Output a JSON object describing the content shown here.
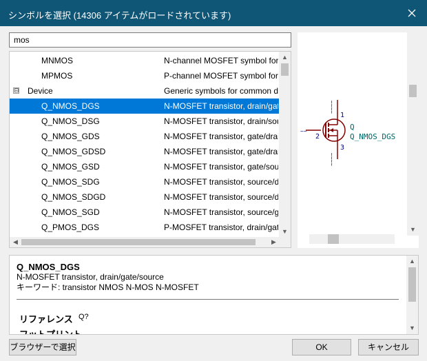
{
  "window": {
    "title": "シンボルを選択 (14306 アイテムがロードされています)"
  },
  "search": {
    "value": "mos"
  },
  "tree": {
    "rows": [
      {
        "name": "MNMOS",
        "desc": "N-channel MOSFET symbol for"
      },
      {
        "name": "MPMOS",
        "desc": "P-channel MOSFET symbol for s"
      },
      {
        "name": "Device",
        "desc": "Generic symbols for common de",
        "expander": "⊟"
      },
      {
        "name": "Q_NMOS_DGS",
        "desc": "N-MOSFET transistor, drain/gate"
      },
      {
        "name": "Q_NMOS_DSG",
        "desc": "N-MOSFET transistor, drain/sou"
      },
      {
        "name": "Q_NMOS_GDS",
        "desc": "N-MOSFET transistor, gate/drain"
      },
      {
        "name": "Q_NMOS_GDSD",
        "desc": "N-MOSFET transistor, gate/drain"
      },
      {
        "name": "Q_NMOS_GSD",
        "desc": "N-MOSFET transistor, gate/sour"
      },
      {
        "name": "Q_NMOS_SDG",
        "desc": "N-MOSFET transistor, source/dr"
      },
      {
        "name": "Q_NMOS_SDGD",
        "desc": "N-MOSFET transistor, source/dr"
      },
      {
        "name": "Q_NMOS_SGD",
        "desc": "N-MOSFET transistor, source/ga"
      },
      {
        "name": "Q_PMOS_DGS",
        "desc": "P-MOSFET transistor, drain/gate"
      }
    ]
  },
  "preview": {
    "ref": "Q",
    "value": "Q_NMOS_DGS",
    "gate_pin": "2",
    "drain_pin": "1",
    "source_pin": "3",
    "gate_net": "~~",
    "drain_net": "~~~~",
    "source_net": "~~~~"
  },
  "details": {
    "name": "Q_NMOS_DGS",
    "description": "N-MOSFET transistor, drain/gate/source",
    "keywords": "キーワード: transistor NMOS N-MOS N-MOSFET",
    "ref_label": "リファレンス",
    "ref_value": "Q?",
    "footprint_label": "フットプリント"
  },
  "buttons": {
    "browser": "ブラウザーで選択",
    "ok": "OK",
    "cancel": "キャンセル"
  },
  "colors": {
    "titlebar": "#0f5575",
    "selection": "#0078d7",
    "symbol_body": "#840000",
    "symbol_text": "#006464",
    "pin_text": "#000084"
  }
}
